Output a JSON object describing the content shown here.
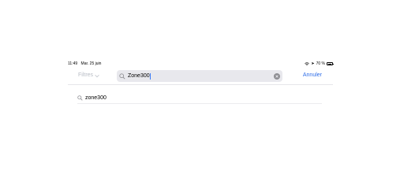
{
  "status_bar": {
    "time": "11:49",
    "date": "Mar. 25 juin",
    "battery": "70 %",
    "battery_level": 0.7,
    "icons": [
      "wifi-icon",
      "location-icon",
      "battery-icon"
    ]
  },
  "nav": {
    "filters_label": "Filtres",
    "search_value": "Zone300",
    "cancel_label": "Annuler"
  },
  "suggestions": [
    {
      "label": "zone300",
      "icon": "search-icon"
    }
  ],
  "colors": {
    "accent": "#2f6ee8",
    "search_bg": "#e8e8ed",
    "muted": "#b7bcc4"
  }
}
